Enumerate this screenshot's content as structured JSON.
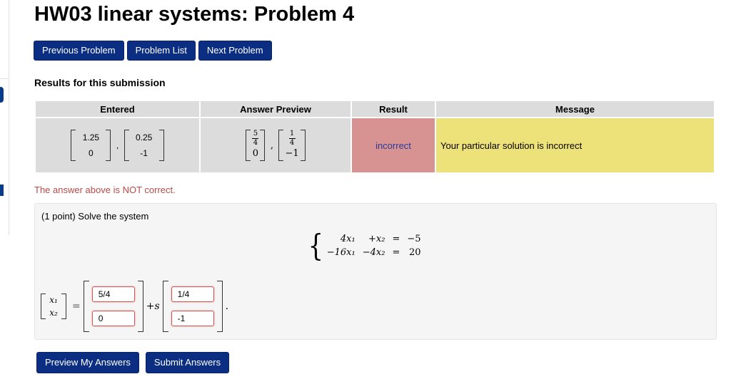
{
  "page_title": "HW03 linear systems: Problem 4",
  "nav": {
    "previous": "Previous Problem",
    "list": "Problem List",
    "next": "Next Problem"
  },
  "results": {
    "title": "Results for this submission",
    "headers": [
      "Entered",
      "Answer Preview",
      "Result",
      "Message"
    ],
    "entered": {
      "vec1": [
        "1.25",
        "0"
      ],
      "vec2": [
        "0.25",
        "-1"
      ],
      "sep": ","
    },
    "preview": {
      "vec1_top_num": "5",
      "vec1_top_den": "4",
      "vec1_bottom": "0",
      "vec2_top_num": "1",
      "vec2_top_den": "4",
      "vec2_bottom": "−1",
      "sep": ","
    },
    "result": "incorrect",
    "message": "Your particular solution is incorrect",
    "colors": {
      "incorrect_bg": "#d79391",
      "message_bg": "#ede17a"
    }
  },
  "feedback": "The answer above is NOT correct.",
  "problem": {
    "intro": "(1 point) Solve the system",
    "equations": [
      [
        "4x₁",
        "+x₂",
        "=",
        "−5"
      ],
      [
        "−16x₁",
        "−4x₂",
        "=",
        "20"
      ]
    ],
    "lhs_vector": [
      "x₁",
      "x₂"
    ],
    "equals": "=",
    "plus_s": "+s",
    "period": ".",
    "inputs": {
      "a1": "5/4",
      "a2": "0",
      "b1": "1/4",
      "b2": "-1"
    }
  },
  "actions": {
    "preview": "Preview My Answers",
    "submit": "Submit Answers"
  },
  "brand_color": "#0b2e82"
}
